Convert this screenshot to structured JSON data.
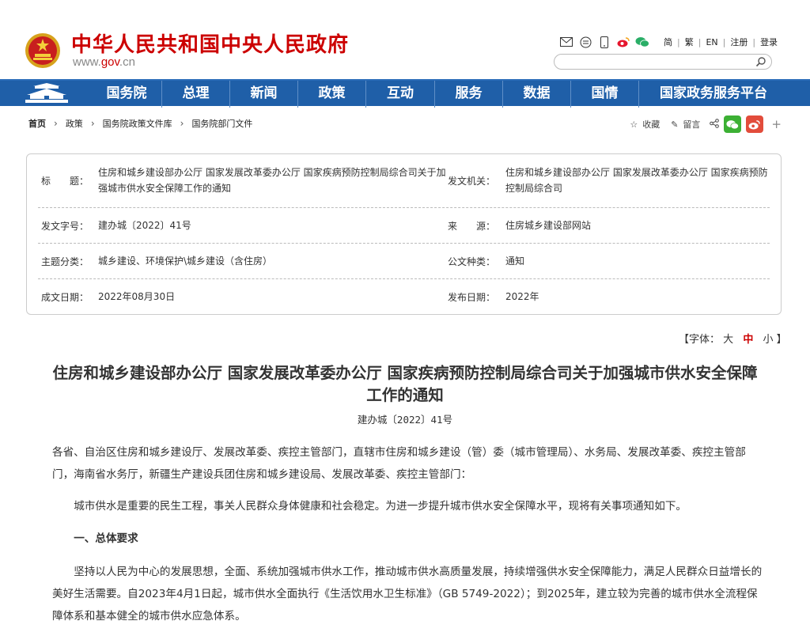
{
  "header": {
    "title": "中华人民共和国中央人民政府",
    "url_prefix": "www.",
    "url_mid": "gov",
    "url_suffix": ".cn",
    "icons": [
      "mail-icon",
      "message-icon",
      "mobile-icon",
      "weibo-icon",
      "wechat-icon"
    ],
    "links": [
      "简",
      "繁",
      "EN",
      "注册",
      "登录"
    ],
    "search_placeholder": ""
  },
  "nav": {
    "items": [
      "国务院",
      "总理",
      "新闻",
      "政策",
      "互动",
      "服务",
      "数据",
      "国情",
      "国家政务服务平台"
    ]
  },
  "breadcrumb": {
    "items": [
      "首页",
      "政策",
      "国务院政策文件库",
      "国务院部门文件"
    ],
    "collect": "收藏",
    "comment": "留言"
  },
  "info": {
    "title_label": "标　　题：",
    "title_value": "住房和城乡建设部办公厅 国家发展改革委办公厅 国家疾病预防控制局综合司关于加强城市供水安全保障工作的通知",
    "issuer_label": "发文机关：",
    "issuer_value": "住房和城乡建设部办公厅 国家发展改革委办公厅 国家疾病预防控制局综合司",
    "doc_no_label": "发文字号：",
    "doc_no_value": "建办城〔2022〕41号",
    "source_label": "来　　源：",
    "source_value": "住房城乡建设部网站",
    "topic_label": "主题分类：",
    "topic_value": "城乡建设、环境保护\\城乡建设（含住房）",
    "type_label": "公文种类：",
    "type_value": "通知",
    "written_label": "成文日期：",
    "written_value": "2022年08月30日",
    "publish_label": "发布日期：",
    "publish_value": "2022年"
  },
  "font_control": {
    "prefix": "【字体：",
    "large": "大",
    "medium": "中",
    "small": "小",
    "suffix": "】"
  },
  "article": {
    "title": "住房和城乡建设部办公厅 国家发展改革委办公厅 国家疾病预防控制局综合司关于加强城市供水安全保障工作的通知",
    "doc_no": "建办城〔2022〕41号",
    "addressee": "各省、自治区住房和城乡建设厅、发展改革委、疾控主管部门，直辖市住房和城乡建设（管）委（城市管理局）、水务局、发展改革委、疾控主管部门，海南省水务厅，新疆生产建设兵团住房和城乡建设局、发展改革委、疾控主管部门：",
    "intro": "城市供水是重要的民生工程，事关人民群众身体健康和社会稳定。为进一步提升城市供水安全保障水平，现将有关事项通知如下。",
    "section1_heading": "一、总体要求",
    "section1_body": "坚持以人民为中心的发展思想，全面、系统加强城市供水工作，推动城市供水高质量发展，持续增强供水安全保障能力，满足人民群众日益增长的美好生活需要。自2023年4月1日起，城市供水全面执行《生活饮用水卫生标准》（GB 5749-2022）；到2025年，建立较为完善的城市供水全流程保障体系和基本健全的城市供水应急体系。"
  },
  "colors": {
    "brand_red": "#cc0000",
    "nav_blue": "#1f5fa8"
  }
}
